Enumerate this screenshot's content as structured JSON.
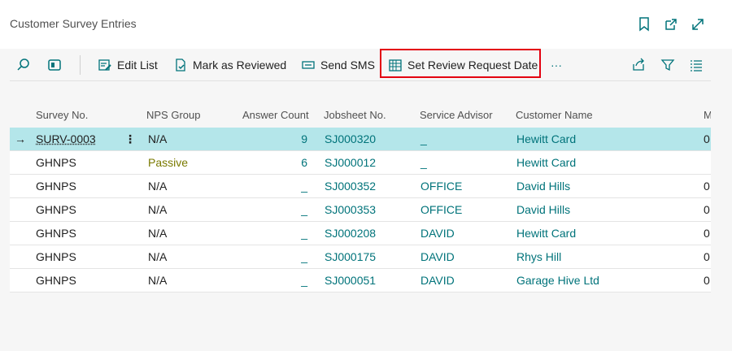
{
  "header": {
    "title": "Customer Survey Entries",
    "icons": [
      "bookmark-icon",
      "open-new-window-icon",
      "expand-icon"
    ]
  },
  "toolbar": {
    "search_icon": "search-icon",
    "view_icon": "view-layout-icon",
    "edit_list": "Edit List",
    "mark_reviewed": "Mark as Reviewed",
    "send_sms": "Send SMS",
    "set_review_date": "Set Review Request Date",
    "more": "···",
    "right_icons": [
      "share-icon",
      "filter-icon",
      "list-view-icon"
    ],
    "highlight_color": "#e3000f"
  },
  "grid": {
    "columns": [
      "Survey No.",
      "NPS Group",
      "Answer Count",
      "Jobsheet No.",
      "Service Advisor",
      "Customer Name",
      "M"
    ],
    "rows": [
      {
        "survey": "SURV-0003",
        "nps": "N/A",
        "answer": "9",
        "jobsheet": "SJ000320",
        "advisor": "_",
        "customer": "Hewitt Card",
        "m": "0"
      },
      {
        "survey": "GHNPS",
        "nps": "Passive",
        "answer": "6",
        "jobsheet": "SJ000012",
        "advisor": "_",
        "customer": "Hewitt Card",
        "m": ""
      },
      {
        "survey": "GHNPS",
        "nps": "N/A",
        "answer": "_",
        "jobsheet": "SJ000352",
        "advisor": "OFFICE",
        "customer": "David Hills",
        "m": "0"
      },
      {
        "survey": "GHNPS",
        "nps": "N/A",
        "answer": "_",
        "jobsheet": "SJ000353",
        "advisor": "OFFICE",
        "customer": "David Hills",
        "m": "0"
      },
      {
        "survey": "GHNPS",
        "nps": "N/A",
        "answer": "_",
        "jobsheet": "SJ000208",
        "advisor": "DAVID",
        "customer": "Hewitt Card",
        "m": "0"
      },
      {
        "survey": "GHNPS",
        "nps": "N/A",
        "answer": "_",
        "jobsheet": "SJ000175",
        "advisor": "DAVID",
        "customer": "Rhys Hill",
        "m": "0"
      },
      {
        "survey": "GHNPS",
        "nps": "N/A",
        "answer": "_",
        "jobsheet": "SJ000051",
        "advisor": "DAVID",
        "customer": "Garage Hive Ltd",
        "m": "0"
      }
    ],
    "selected_row_color": "#b4e6ea",
    "link_color": "#00737a"
  }
}
